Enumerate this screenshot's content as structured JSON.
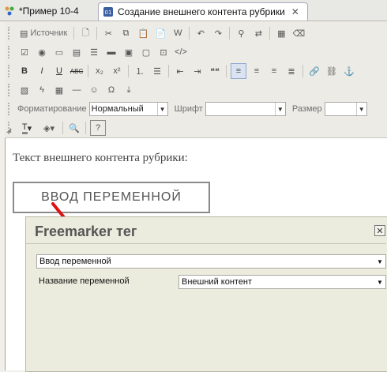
{
  "tabs": [
    {
      "label": "*Пример 10-4",
      "active": false
    },
    {
      "label": "Создание внешнего контента рубрики",
      "active": true
    }
  ],
  "toolbar": {
    "source_label": "Источник",
    "format_label": "Форматирование",
    "format_value": "Нормальный",
    "font_label": "Шрифт",
    "font_value": "",
    "size_label": "Размер",
    "size_value": "",
    "bold": "B",
    "italic": "I",
    "underline": "U",
    "strike": "ABC",
    "subscript": "x₂",
    "superscript": "x²",
    "quote": "❝❝",
    "text_color": "T"
  },
  "content": {
    "text": "Текст внешнего контента рубрики:",
    "variable_box": "ВВОД ПЕРЕМЕННОЙ"
  },
  "dialog": {
    "title": "Freemarker тег",
    "type_value": "Ввод переменной",
    "var_name_label": "Название переменной",
    "var_name_value": "Внешний контент"
  },
  "colors": {
    "pointer": "#dd1111",
    "active_tab_border": "#aab"
  }
}
